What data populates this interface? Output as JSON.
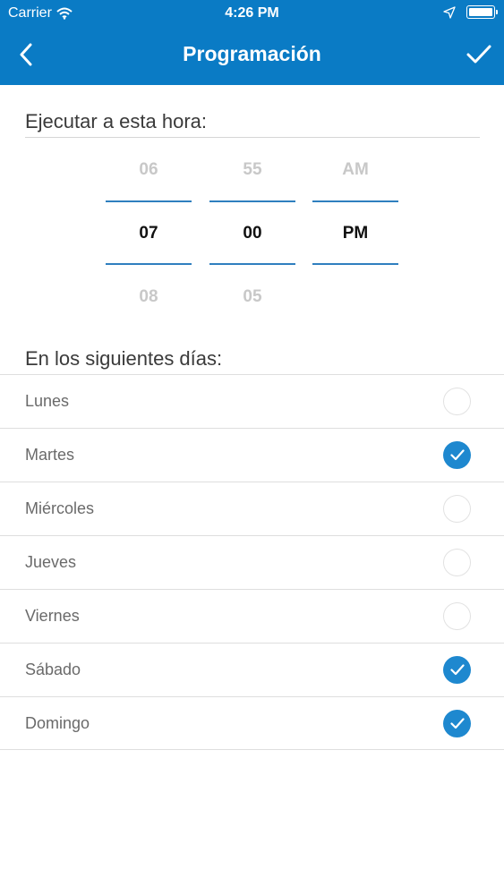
{
  "status_bar": {
    "carrier": "Carrier",
    "time": "4:26 PM",
    "battery_level": 1.0
  },
  "navbar": {
    "title": "Programación"
  },
  "time_section": {
    "title": "Ejecutar a esta hora:"
  },
  "picker": {
    "hour": {
      "above": "06",
      "selected": "07",
      "below": "08"
    },
    "minute": {
      "above": "55",
      "selected": "00",
      "below": "05"
    },
    "period": {
      "above": "AM",
      "selected": "PM",
      "below": ""
    }
  },
  "days_section": {
    "title": "En los siguientes días:"
  },
  "days": [
    {
      "label": "Lunes",
      "checked": false
    },
    {
      "label": "Martes",
      "checked": true
    },
    {
      "label": "Miércoles",
      "checked": false
    },
    {
      "label": "Jueves",
      "checked": false
    },
    {
      "label": "Viernes",
      "checked": false
    },
    {
      "label": "Sábado",
      "checked": true
    },
    {
      "label": "Domingo",
      "checked": true
    }
  ],
  "colors": {
    "accent": "#0a7bc5",
    "check_on": "#1e88cf",
    "picker_line": "#2f7fbf"
  },
  "icons": {
    "back": "chevron-left-icon",
    "done": "checkmark-icon",
    "wifi": "wifi-icon",
    "location": "location-arrow-icon",
    "battery": "battery-icon"
  }
}
